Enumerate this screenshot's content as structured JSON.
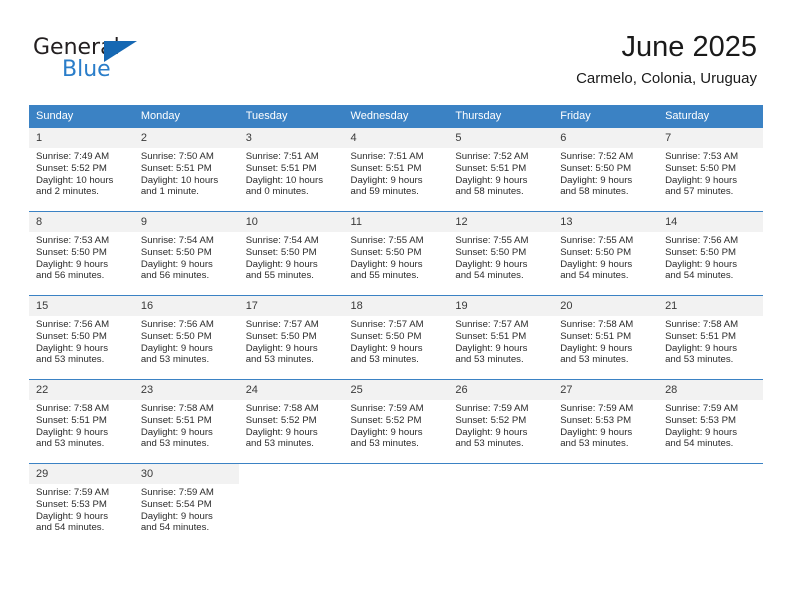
{
  "brand": {
    "name_top": "General",
    "name_bottom": "Blue",
    "triangle_color": "#1668b3",
    "blue_text_color": "#2a7dc9"
  },
  "header": {
    "title": "June 2025",
    "subtitle": "Carmelo, Colonia, Uruguay"
  },
  "colors": {
    "header_row": "#3b82c4",
    "day_number_band": "#f2f2f2",
    "text": "#1a1a1a"
  },
  "weekday_headers": [
    "Sunday",
    "Monday",
    "Tuesday",
    "Wednesday",
    "Thursday",
    "Friday",
    "Saturday"
  ],
  "weeks": [
    [
      {
        "day": "1",
        "sunrise": "Sunrise: 7:49 AM",
        "sunset": "Sunset: 5:52 PM",
        "daylight_line1": "Daylight: 10 hours",
        "daylight_line2": "and 2 minutes."
      },
      {
        "day": "2",
        "sunrise": "Sunrise: 7:50 AM",
        "sunset": "Sunset: 5:51 PM",
        "daylight_line1": "Daylight: 10 hours",
        "daylight_line2": "and 1 minute."
      },
      {
        "day": "3",
        "sunrise": "Sunrise: 7:51 AM",
        "sunset": "Sunset: 5:51 PM",
        "daylight_line1": "Daylight: 10 hours",
        "daylight_line2": "and 0 minutes."
      },
      {
        "day": "4",
        "sunrise": "Sunrise: 7:51 AM",
        "sunset": "Sunset: 5:51 PM",
        "daylight_line1": "Daylight: 9 hours",
        "daylight_line2": "and 59 minutes."
      },
      {
        "day": "5",
        "sunrise": "Sunrise: 7:52 AM",
        "sunset": "Sunset: 5:51 PM",
        "daylight_line1": "Daylight: 9 hours",
        "daylight_line2": "and 58 minutes."
      },
      {
        "day": "6",
        "sunrise": "Sunrise: 7:52 AM",
        "sunset": "Sunset: 5:50 PM",
        "daylight_line1": "Daylight: 9 hours",
        "daylight_line2": "and 58 minutes."
      },
      {
        "day": "7",
        "sunrise": "Sunrise: 7:53 AM",
        "sunset": "Sunset: 5:50 PM",
        "daylight_line1": "Daylight: 9 hours",
        "daylight_line2": "and 57 minutes."
      }
    ],
    [
      {
        "day": "8",
        "sunrise": "Sunrise: 7:53 AM",
        "sunset": "Sunset: 5:50 PM",
        "daylight_line1": "Daylight: 9 hours",
        "daylight_line2": "and 56 minutes."
      },
      {
        "day": "9",
        "sunrise": "Sunrise: 7:54 AM",
        "sunset": "Sunset: 5:50 PM",
        "daylight_line1": "Daylight: 9 hours",
        "daylight_line2": "and 56 minutes."
      },
      {
        "day": "10",
        "sunrise": "Sunrise: 7:54 AM",
        "sunset": "Sunset: 5:50 PM",
        "daylight_line1": "Daylight: 9 hours",
        "daylight_line2": "and 55 minutes."
      },
      {
        "day": "11",
        "sunrise": "Sunrise: 7:55 AM",
        "sunset": "Sunset: 5:50 PM",
        "daylight_line1": "Daylight: 9 hours",
        "daylight_line2": "and 55 minutes."
      },
      {
        "day": "12",
        "sunrise": "Sunrise: 7:55 AM",
        "sunset": "Sunset: 5:50 PM",
        "daylight_line1": "Daylight: 9 hours",
        "daylight_line2": "and 54 minutes."
      },
      {
        "day": "13",
        "sunrise": "Sunrise: 7:55 AM",
        "sunset": "Sunset: 5:50 PM",
        "daylight_line1": "Daylight: 9 hours",
        "daylight_line2": "and 54 minutes."
      },
      {
        "day": "14",
        "sunrise": "Sunrise: 7:56 AM",
        "sunset": "Sunset: 5:50 PM",
        "daylight_line1": "Daylight: 9 hours",
        "daylight_line2": "and 54 minutes."
      }
    ],
    [
      {
        "day": "15",
        "sunrise": "Sunrise: 7:56 AM",
        "sunset": "Sunset: 5:50 PM",
        "daylight_line1": "Daylight: 9 hours",
        "daylight_line2": "and 53 minutes."
      },
      {
        "day": "16",
        "sunrise": "Sunrise: 7:56 AM",
        "sunset": "Sunset: 5:50 PM",
        "daylight_line1": "Daylight: 9 hours",
        "daylight_line2": "and 53 minutes."
      },
      {
        "day": "17",
        "sunrise": "Sunrise: 7:57 AM",
        "sunset": "Sunset: 5:50 PM",
        "daylight_line1": "Daylight: 9 hours",
        "daylight_line2": "and 53 minutes."
      },
      {
        "day": "18",
        "sunrise": "Sunrise: 7:57 AM",
        "sunset": "Sunset: 5:50 PM",
        "daylight_line1": "Daylight: 9 hours",
        "daylight_line2": "and 53 minutes."
      },
      {
        "day": "19",
        "sunrise": "Sunrise: 7:57 AM",
        "sunset": "Sunset: 5:51 PM",
        "daylight_line1": "Daylight: 9 hours",
        "daylight_line2": "and 53 minutes."
      },
      {
        "day": "20",
        "sunrise": "Sunrise: 7:58 AM",
        "sunset": "Sunset: 5:51 PM",
        "daylight_line1": "Daylight: 9 hours",
        "daylight_line2": "and 53 minutes."
      },
      {
        "day": "21",
        "sunrise": "Sunrise: 7:58 AM",
        "sunset": "Sunset: 5:51 PM",
        "daylight_line1": "Daylight: 9 hours",
        "daylight_line2": "and 53 minutes."
      }
    ],
    [
      {
        "day": "22",
        "sunrise": "Sunrise: 7:58 AM",
        "sunset": "Sunset: 5:51 PM",
        "daylight_line1": "Daylight: 9 hours",
        "daylight_line2": "and 53 minutes."
      },
      {
        "day": "23",
        "sunrise": "Sunrise: 7:58 AM",
        "sunset": "Sunset: 5:51 PM",
        "daylight_line1": "Daylight: 9 hours",
        "daylight_line2": "and 53 minutes."
      },
      {
        "day": "24",
        "sunrise": "Sunrise: 7:58 AM",
        "sunset": "Sunset: 5:52 PM",
        "daylight_line1": "Daylight: 9 hours",
        "daylight_line2": "and 53 minutes."
      },
      {
        "day": "25",
        "sunrise": "Sunrise: 7:59 AM",
        "sunset": "Sunset: 5:52 PM",
        "daylight_line1": "Daylight: 9 hours",
        "daylight_line2": "and 53 minutes."
      },
      {
        "day": "26",
        "sunrise": "Sunrise: 7:59 AM",
        "sunset": "Sunset: 5:52 PM",
        "daylight_line1": "Daylight: 9 hours",
        "daylight_line2": "and 53 minutes."
      },
      {
        "day": "27",
        "sunrise": "Sunrise: 7:59 AM",
        "sunset": "Sunset: 5:53 PM",
        "daylight_line1": "Daylight: 9 hours",
        "daylight_line2": "and 53 minutes."
      },
      {
        "day": "28",
        "sunrise": "Sunrise: 7:59 AM",
        "sunset": "Sunset: 5:53 PM",
        "daylight_line1": "Daylight: 9 hours",
        "daylight_line2": "and 54 minutes."
      }
    ],
    [
      {
        "day": "29",
        "sunrise": "Sunrise: 7:59 AM",
        "sunset": "Sunset: 5:53 PM",
        "daylight_line1": "Daylight: 9 hours",
        "daylight_line2": "and 54 minutes."
      },
      {
        "day": "30",
        "sunrise": "Sunrise: 7:59 AM",
        "sunset": "Sunset: 5:54 PM",
        "daylight_line1": "Daylight: 9 hours",
        "daylight_line2": "and 54 minutes."
      },
      {
        "day": "",
        "sunrise": "",
        "sunset": "",
        "daylight_line1": "",
        "daylight_line2": ""
      },
      {
        "day": "",
        "sunrise": "",
        "sunset": "",
        "daylight_line1": "",
        "daylight_line2": ""
      },
      {
        "day": "",
        "sunrise": "",
        "sunset": "",
        "daylight_line1": "",
        "daylight_line2": ""
      },
      {
        "day": "",
        "sunrise": "",
        "sunset": "",
        "daylight_line1": "",
        "daylight_line2": ""
      },
      {
        "day": "",
        "sunrise": "",
        "sunset": "",
        "daylight_line1": "",
        "daylight_line2": ""
      }
    ]
  ]
}
